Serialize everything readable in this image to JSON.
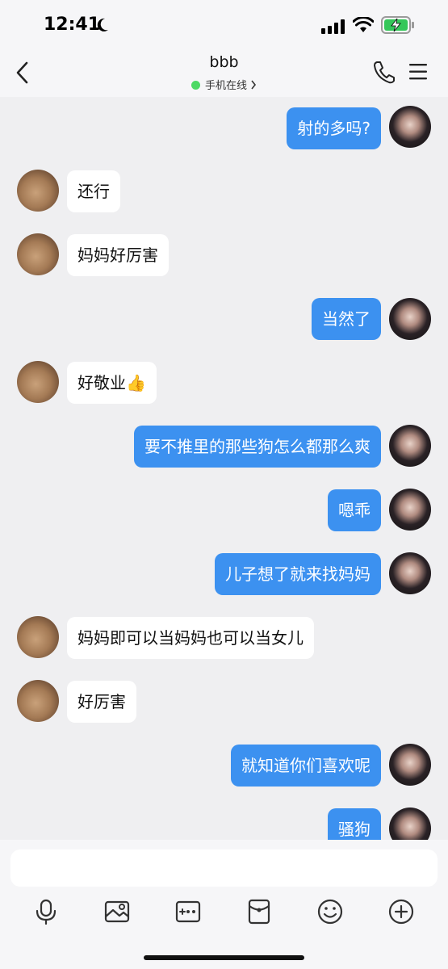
{
  "status_bar": {
    "time": "12:41",
    "icons": [
      "moon-icon",
      "cellular-signal-icon",
      "wifi-icon",
      "battery-charging-icon"
    ]
  },
  "header": {
    "title": "bbb",
    "subtitle": "手机在线",
    "icons": [
      "back-chevron-icon",
      "phone-icon",
      "menu-icon"
    ]
  },
  "messages": [
    {
      "side": "out",
      "text": "射的多吗?"
    },
    {
      "side": "in",
      "text": "还行"
    },
    {
      "side": "in",
      "text": "妈妈好厉害"
    },
    {
      "side": "out",
      "text": "当然了"
    },
    {
      "side": "in",
      "text": "好敬业👍"
    },
    {
      "side": "out",
      "text": "要不推里的那些狗怎么都那么爽"
    },
    {
      "side": "out",
      "text": "嗯乖"
    },
    {
      "side": "out",
      "text": "儿子想了就来找妈妈"
    },
    {
      "side": "in",
      "text": "妈妈即可以当妈妈也可以当女儿"
    },
    {
      "side": "in",
      "text": "好厉害"
    },
    {
      "side": "out",
      "text": "就知道你们喜欢呢"
    },
    {
      "side": "out",
      "text": "骚狗"
    }
  ],
  "input": {
    "value": "",
    "placeholder": ""
  },
  "toolbar": {
    "icons": [
      "microphone-icon",
      "image-icon",
      "camera-icon",
      "red-packet-icon",
      "emoji-icon",
      "plus-icon"
    ]
  },
  "colors": {
    "outgoing_bubble": "#3c91f0",
    "incoming_bubble": "#ffffff",
    "background": "#efeff1",
    "online": "#4cd964"
  }
}
